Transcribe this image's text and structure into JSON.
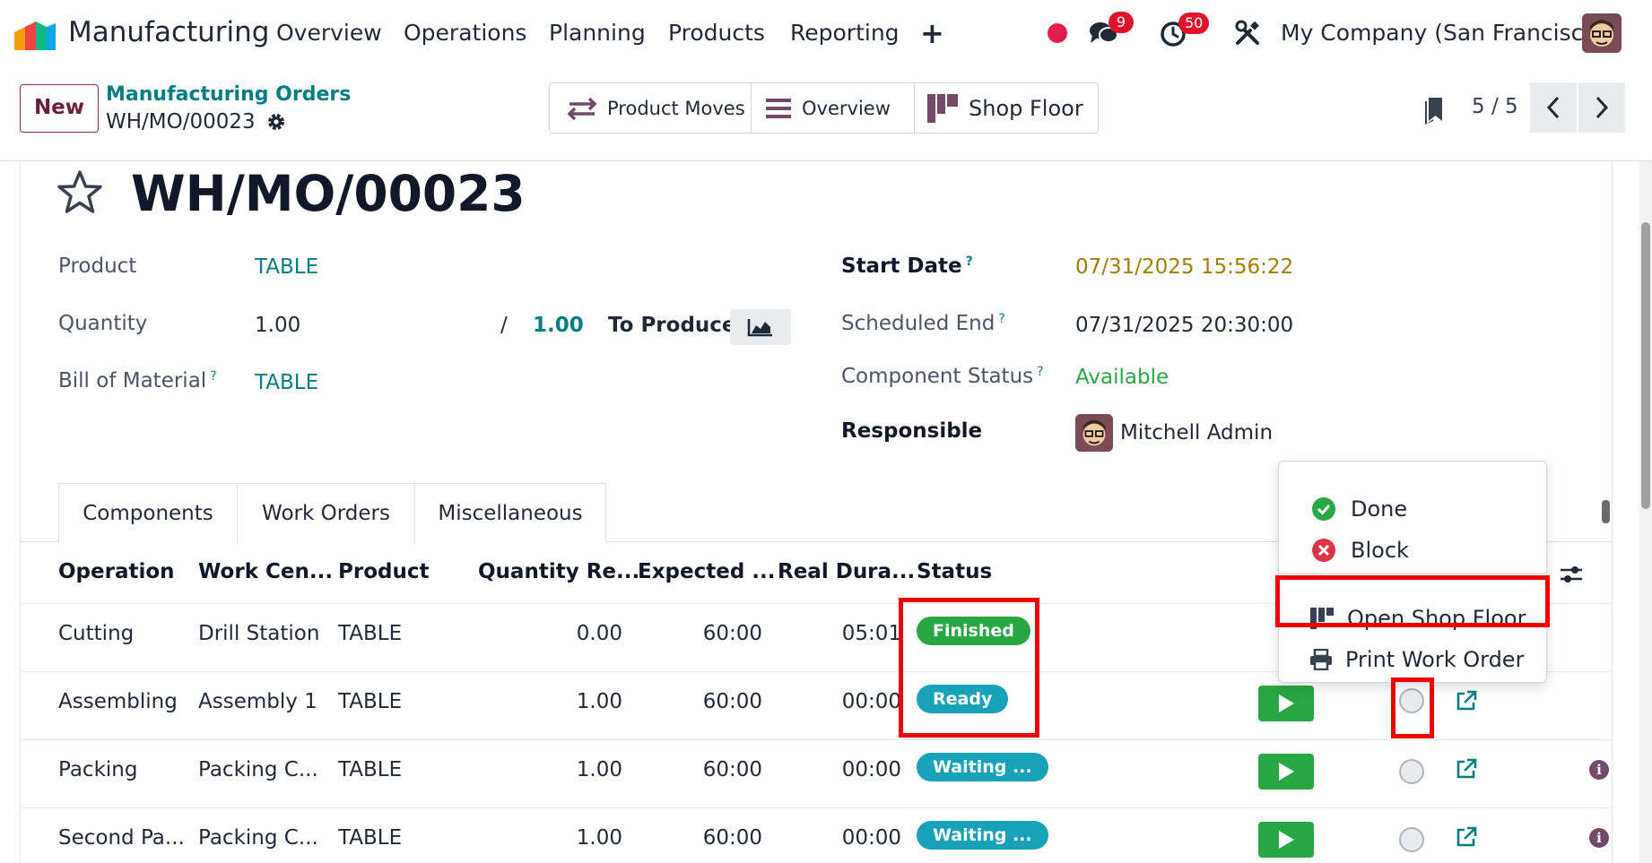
{
  "navbar": {
    "app_name": "Manufacturing",
    "menu": [
      "Overview",
      "Operations",
      "Planning",
      "Products",
      "Reporting"
    ],
    "plus": "+",
    "messages_count": "9",
    "activities_count": "50",
    "company": "My Company (San Francisco)"
  },
  "control_panel": {
    "new_label": "New",
    "breadcrumb_parent": "Manufacturing Orders",
    "breadcrumb_current": "WH/MO/00023",
    "smart_buttons": [
      "Product Moves",
      "Overview",
      "Shop Floor"
    ],
    "pager": "5 / 5"
  },
  "form": {
    "title": "WH/MO/00023",
    "product_label": "Product",
    "product_value": "TABLE",
    "quantity_label": "Quantity",
    "quantity_value": "1.00",
    "quantity_sep": "/",
    "quantity_to_produce": "1.00",
    "to_produce_label": "To Produce",
    "bom_label": "Bill of Material",
    "bom_value": "TABLE",
    "start_date_label": "Start Date",
    "start_date_value": "07/31/2025 15:56:22",
    "scheduled_end_label": "Scheduled End",
    "scheduled_end_value": "07/31/2025 20:30:00",
    "component_status_label": "Component Status",
    "component_status_value": "Available",
    "responsible_label": "Responsible",
    "responsible_value": "Mitchell Admin",
    "help_mark": "?"
  },
  "tabs": [
    "Components",
    "Work Orders",
    "Miscellaneous"
  ],
  "table": {
    "headers": [
      "Operation",
      "Work Cen...",
      "Product",
      "Quantity Re...",
      "Expected ...",
      "Real Dura...",
      "Status"
    ],
    "rows": [
      {
        "operation": "Cutting",
        "work_center": "Drill Station",
        "product": "TABLE",
        "qty": "0.00",
        "expected": "60:00",
        "real": "05:01",
        "status": "Finished"
      },
      {
        "operation": "Assembling",
        "work_center": "Assembly 1",
        "product": "TABLE",
        "qty": "1.00",
        "expected": "60:00",
        "real": "00:00",
        "status": "Ready"
      },
      {
        "operation": "Packing",
        "work_center": "Packing C...",
        "product": "TABLE",
        "qty": "1.00",
        "expected": "60:00",
        "real": "00:00",
        "status": "Waiting ..."
      },
      {
        "operation": "Second Pa...",
        "work_center": "Packing C...",
        "product": "TABLE",
        "qty": "1.00",
        "expected": "60:00",
        "real": "00:00",
        "status": "Waiting ..."
      }
    ]
  },
  "dropdown": {
    "done": "Done",
    "block": "Block",
    "open_shop_floor": "Open Shop Floor",
    "print_work_order": "Print Work Order"
  },
  "colors": {
    "brand": "#714b67",
    "link": "#017e84",
    "finished": "#28a745",
    "ready": "#17a2b8",
    "waiting": "#17a2b8",
    "highlight": "#ef0000",
    "start_date": "#a67c00",
    "available": "#28a745"
  },
  "icons": [
    "app-logo-icon",
    "chat-icon",
    "clock-icon",
    "tools-icon",
    "gear-icon",
    "arrows-icon",
    "list-icon",
    "shop-floor-icon",
    "bookmark-icon",
    "chevron-left-icon",
    "chevron-right-icon",
    "star-icon",
    "chart-icon",
    "play-icon",
    "external-link-icon",
    "info-icon",
    "check-circle-icon",
    "x-circle-icon",
    "print-icon",
    "sliders-icon"
  ]
}
